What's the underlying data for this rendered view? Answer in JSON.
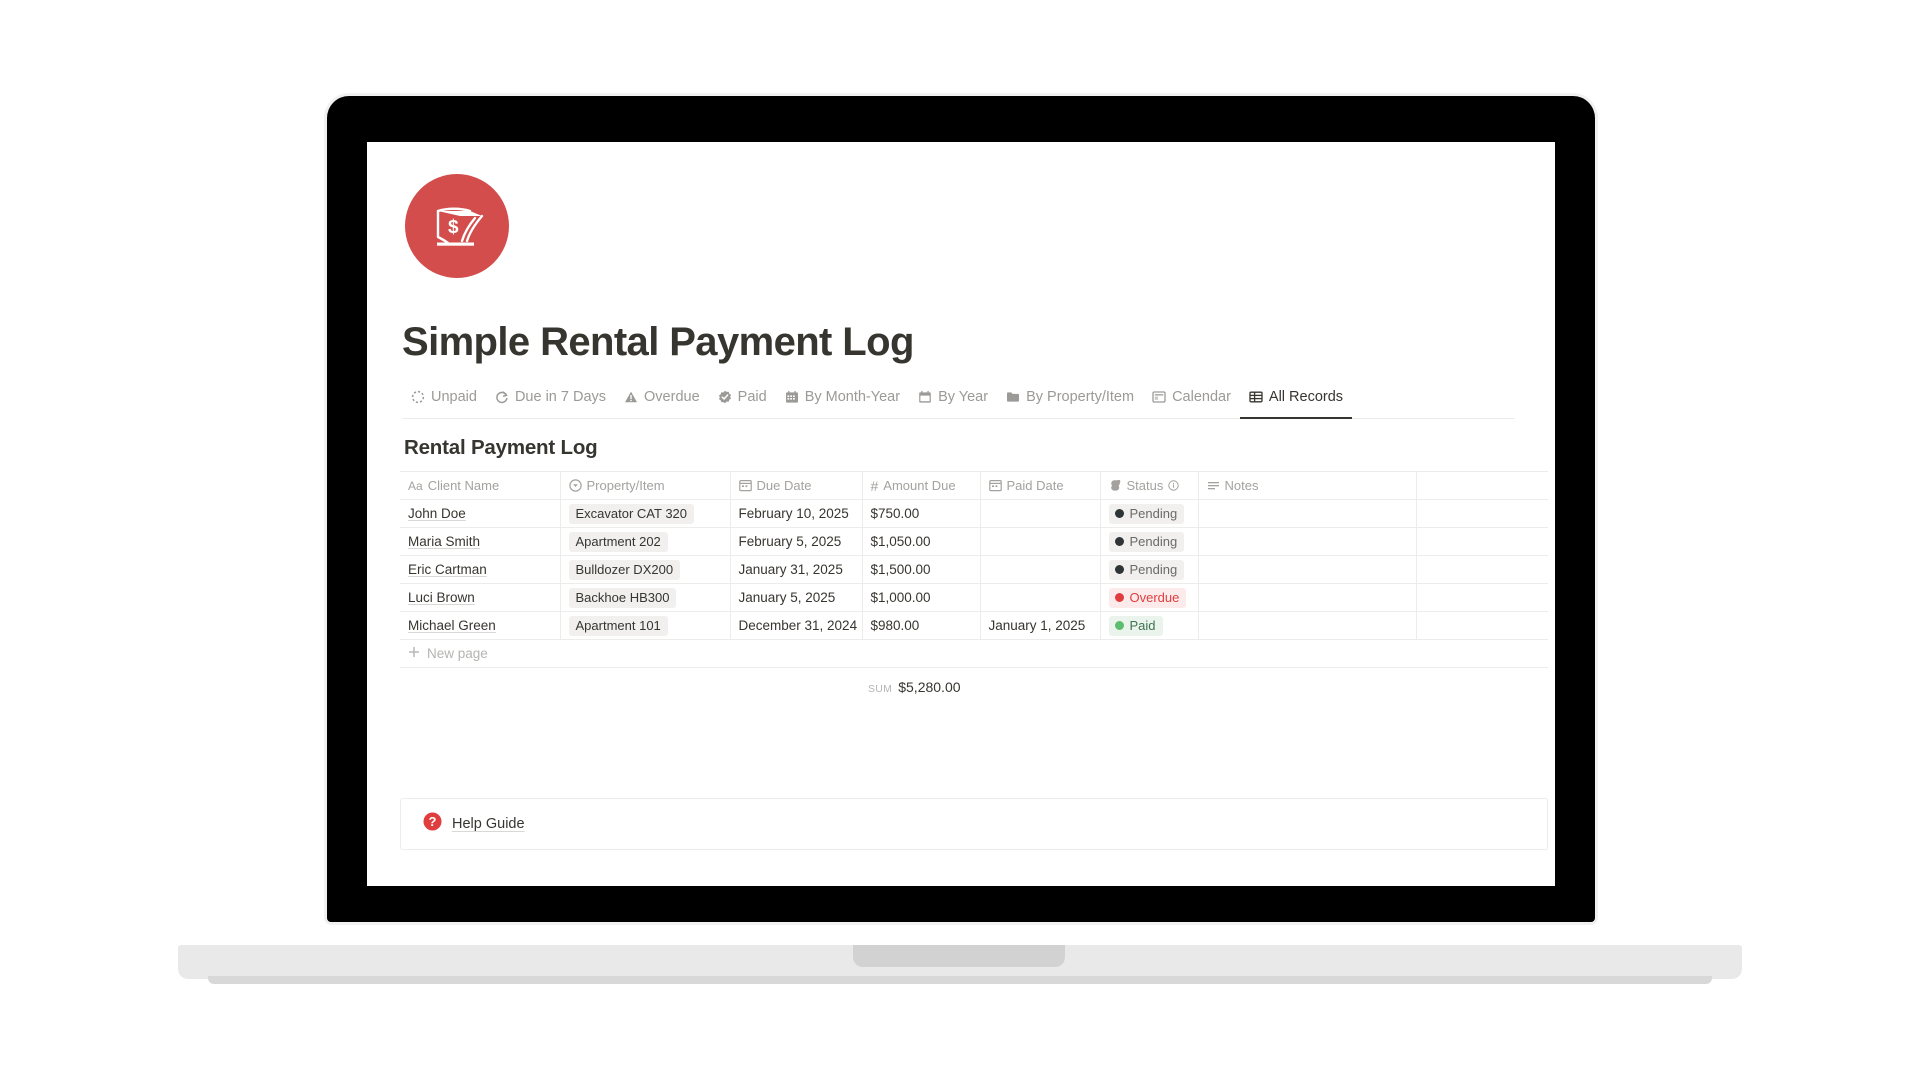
{
  "brand": {
    "logo_icon": "money-stack-dollar-icon",
    "logo_color": "#d24d4b"
  },
  "page": {
    "title": "Simple Rental Payment Log"
  },
  "view_tabs": [
    {
      "label": "Unpaid",
      "icon": "dashed-circle-icon",
      "active": false
    },
    {
      "label": "Due in 7 Days",
      "icon": "refresh-clock-icon",
      "active": false
    },
    {
      "label": "Overdue",
      "icon": "warning-triangle-icon",
      "active": false
    },
    {
      "label": "Paid",
      "icon": "check-badge-icon",
      "active": false
    },
    {
      "label": "By Month-Year",
      "icon": "calendar-grid-icon",
      "active": false
    },
    {
      "label": "By Year",
      "icon": "calendar-icon",
      "active": false
    },
    {
      "label": "By Property/Item",
      "icon": "folder-icon",
      "active": false
    },
    {
      "label": "Calendar",
      "icon": "calendar-view-icon",
      "active": false
    },
    {
      "label": "All Records",
      "icon": "table-icon",
      "active": true
    }
  ],
  "database": {
    "title": "Rental Payment Log",
    "columns": [
      {
        "label": "Client Name",
        "icon": "title-aa-icon"
      },
      {
        "label": "Property/Item",
        "icon": "select-icon"
      },
      {
        "label": "Due Date",
        "icon": "date-icon"
      },
      {
        "label": "Amount Due",
        "icon": "number-hash-icon"
      },
      {
        "label": "Paid Date",
        "icon": "date-icon"
      },
      {
        "label": "Status",
        "icon": "status-icon",
        "info": true
      },
      {
        "label": "Notes",
        "icon": "text-lines-icon"
      }
    ],
    "rows": [
      {
        "client_name": "John Doe",
        "property_item": "Excavator CAT 320",
        "due_date": "February 10, 2025",
        "amount_due": "$750.00",
        "paid_date": "",
        "status": "Pending",
        "status_type": "pending",
        "notes": ""
      },
      {
        "client_name": "Maria Smith",
        "property_item": "Apartment 202",
        "due_date": "February 5, 2025",
        "amount_due": "$1,050.00",
        "paid_date": "",
        "status": "Pending",
        "status_type": "pending",
        "notes": ""
      },
      {
        "client_name": "Eric Cartman",
        "property_item": "Bulldozer DX200",
        "due_date": "January 31, 2025",
        "amount_due": "$1,500.00",
        "paid_date": "",
        "status": "Pending",
        "status_type": "pending",
        "notes": ""
      },
      {
        "client_name": "Luci Brown",
        "property_item": "Backhoe HB300",
        "due_date": "January 5, 2025",
        "amount_due": "$1,000.00",
        "paid_date": "",
        "status": "Overdue",
        "status_type": "overdue",
        "notes": ""
      },
      {
        "client_name": "Michael Green",
        "property_item": "Apartment 101",
        "due_date": "December 31, 2024",
        "amount_due": "$980.00",
        "paid_date": "January 1, 2025",
        "status": "Paid",
        "status_type": "paid",
        "notes": ""
      }
    ],
    "new_page_label": "New page",
    "sum_label": "SUM",
    "sum_value": "$5,280.00"
  },
  "footer": {
    "help_label": "Help Guide",
    "help_icon": "question-circle-icon",
    "help_icon_color": "#e03e3e"
  },
  "colors": {
    "accent_red": "#d24d4b",
    "text_primary": "#37352f",
    "text_muted": "#9b9a97",
    "status_pending": "#2f3437",
    "status_overdue": "#e03e3e",
    "status_paid": "#5cbd6e",
    "border": "#ececeb"
  }
}
